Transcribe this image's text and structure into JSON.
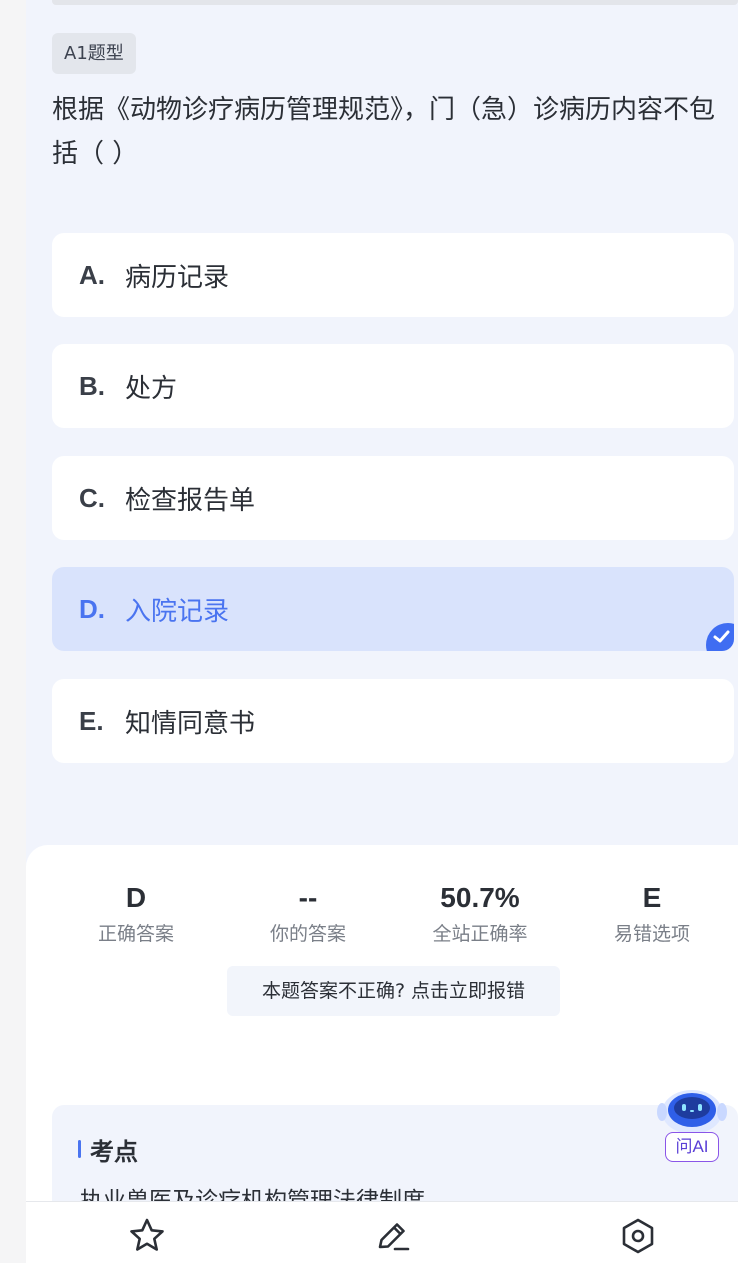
{
  "question": {
    "type_badge": "A1题型",
    "text": "根据《动物诊疗病历管理规范》，门（急）诊病历内容不包括（ ）"
  },
  "options": [
    {
      "letter": "A.",
      "text": "病历记录",
      "selected": false
    },
    {
      "letter": "B.",
      "text": "处方",
      "selected": false
    },
    {
      "letter": "C.",
      "text": "检查报告单",
      "selected": false
    },
    {
      "letter": "D.",
      "text": "入院记录",
      "selected": true
    },
    {
      "letter": "E.",
      "text": "知情同意书",
      "selected": false
    }
  ],
  "stats": [
    {
      "value": "D",
      "label": "正确答案"
    },
    {
      "value": "--",
      "label": "你的答案"
    },
    {
      "value": "50.7%",
      "label": "全站正确率"
    },
    {
      "value": "E",
      "label": "易错选项"
    }
  ],
  "report_button": "本题答案不正确? 点击立即报错",
  "knowledge_point": {
    "title": "考点",
    "text": "执业兽医及诊疗机构管理法律制度"
  },
  "ai_assistant": {
    "label": "问AI"
  },
  "bottom_nav": [
    {
      "icon": "star-icon"
    },
    {
      "icon": "edit-icon"
    },
    {
      "icon": "settings-icon"
    }
  ],
  "colors": {
    "accent": "#4a74f0",
    "selected_bg": "#d9e3fc",
    "page_bg": "#f1f4fc"
  }
}
